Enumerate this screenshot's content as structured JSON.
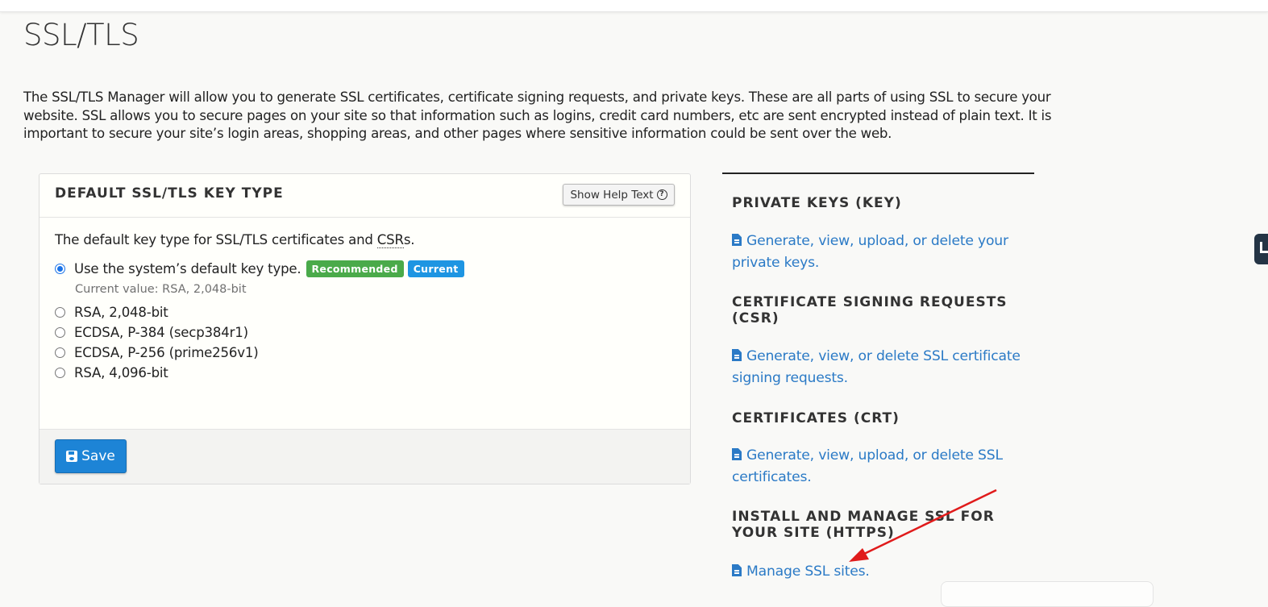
{
  "page": {
    "title": "SSL/TLS",
    "intro": "The SSL/TLS Manager will allow you to generate SSL certificates, certificate signing requests, and private keys. These are all parts of using SSL to secure your website. SSL allows you to secure pages on your site so that information such as logins, credit card numbers, etc are sent encrypted instead of plain text. It is important to secure your site’s login areas, shopping areas, and other pages where sensitive information could be sent over the web."
  },
  "key_type_panel": {
    "title": "DEFAULT SSL/TLS KEY TYPE",
    "help_button_label": "Show Help Text",
    "description_prefix": "The default key type for SSL/TLS certificates and ",
    "description_abbr": "CSR",
    "description_suffix": "s.",
    "options": [
      {
        "label": "Use the system’s default key type.",
        "checked": true
      },
      {
        "label": "RSA, 2,048-bit",
        "checked": false
      },
      {
        "label": "ECDSA, P-384 (secp384r1)",
        "checked": false
      },
      {
        "label": "ECDSA, P-256 (prime256v1)",
        "checked": false
      },
      {
        "label": "RSA, 4,096-bit",
        "checked": false
      }
    ],
    "badges": {
      "recommended": "Recommended",
      "current": "Current"
    },
    "current_value": "Current value: RSA, 2,048-bit",
    "save_label": "Save"
  },
  "sections": [
    {
      "title": "PRIVATE KEYS (KEY)",
      "link": "Generate, view, upload, or delete your private keys."
    },
    {
      "title": "CERTIFICATE SIGNING REQUESTS (CSR)",
      "link": "Generate, view, or delete SSL certificate signing requests."
    },
    {
      "title": "CERTIFICATES (CRT)",
      "link": "Generate, view, upload, or delete SSL certificates."
    },
    {
      "title": "INSTALL AND MANAGE SSL FOR YOUR SITE (HTTPS)",
      "link": "Manage SSL sites."
    }
  ],
  "icons": {
    "help": "question-circle-icon",
    "save": "floppy-disk-icon",
    "link": "file-text-icon",
    "annotation": "red-arrow-annotation"
  },
  "colors": {
    "link": "#2b7ac6",
    "primary_button": "#1d84d6",
    "recommended_badge": "#4aaa4a",
    "current_badge": "#1e95e2",
    "annotation_arrow": "#e01b1b"
  }
}
